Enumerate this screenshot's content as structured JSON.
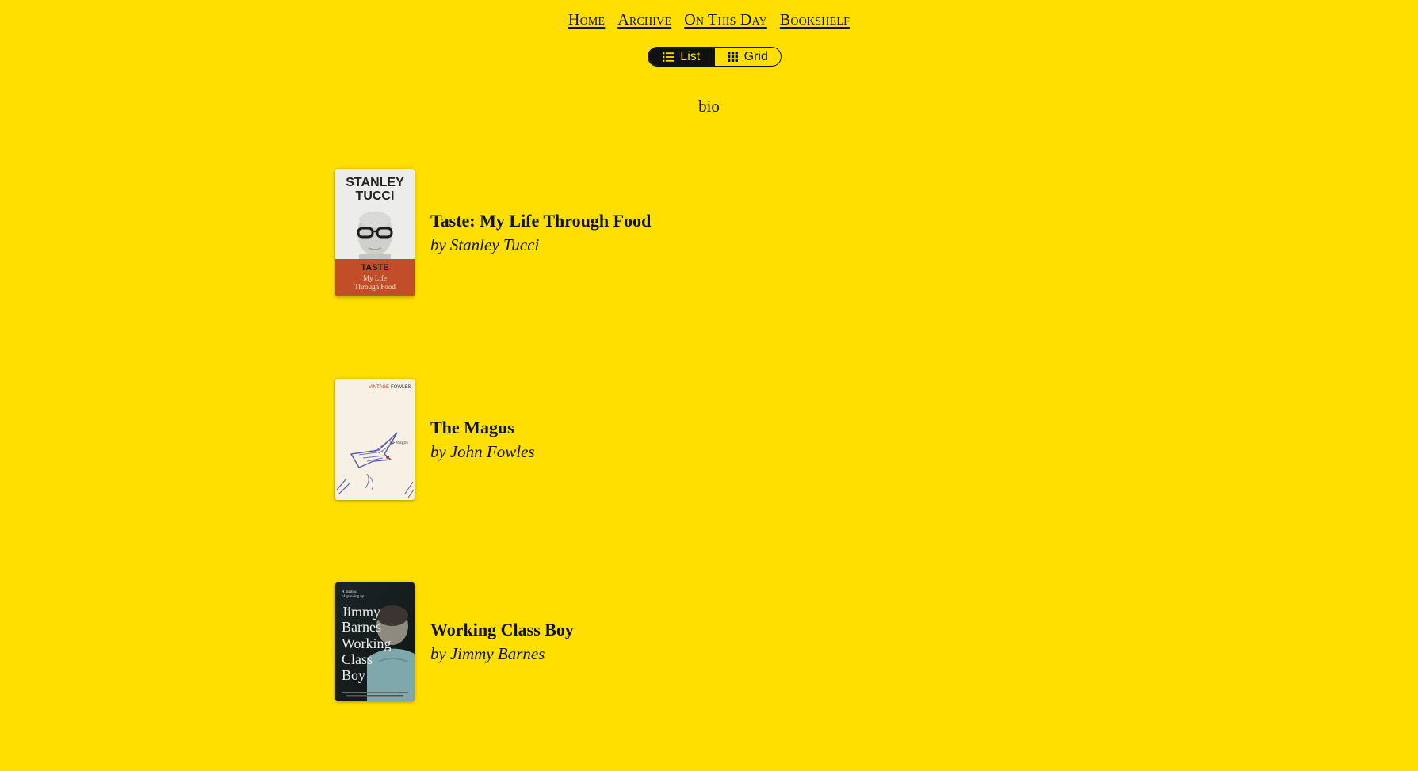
{
  "nav": {
    "items": [
      {
        "label": "Home"
      },
      {
        "label": "Archive"
      },
      {
        "label": "On This Day"
      },
      {
        "label": "Bookshelf"
      }
    ]
  },
  "view_toggle": {
    "list_label": "List",
    "grid_label": "Grid",
    "selected": "List",
    "list_icon": "list-icon",
    "grid_icon": "grid-icon"
  },
  "page": {
    "title": "bio"
  },
  "colors": {
    "background": "#FFDF00",
    "text": "#111111"
  },
  "books": [
    {
      "title": "Taste: My Life Through Food",
      "by": "by",
      "author": "Stanley Tucci",
      "cover": {
        "author_line1": "STANLEY",
        "author_line2": "TUCCI",
        "title": "TASTE",
        "subtitle_line1": "My Life",
        "subtitle_line2": "Through Food"
      }
    },
    {
      "title": "The Magus",
      "by": "by",
      "author": "John Fowles",
      "cover": {
        "publisher": "VINTAGE",
        "author": "FOWLES",
        "title": "The Magus"
      }
    },
    {
      "title": "Working Class Boy",
      "by": "by",
      "author": "Jimmy Barnes",
      "cover": {
        "tagline_line1": "A memoir",
        "tagline_line2": "of growing up",
        "line1": "Jimmy",
        "line2": "Barnes",
        "line3": "Working",
        "line4": "Class",
        "line5": "Boy"
      }
    }
  ]
}
